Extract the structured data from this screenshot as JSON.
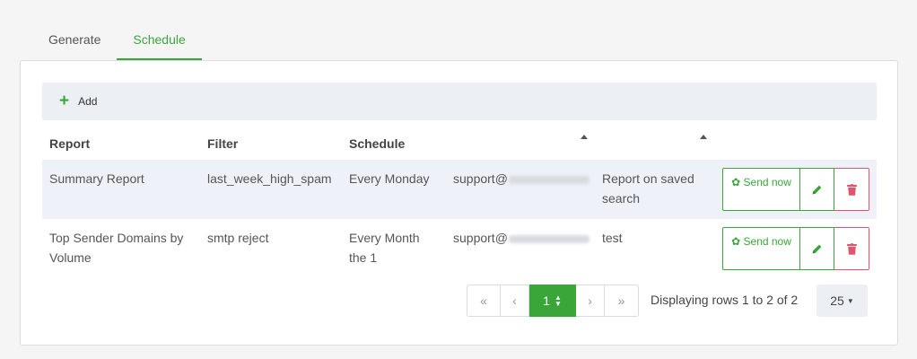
{
  "tabs": [
    {
      "label": "Generate",
      "active": false
    },
    {
      "label": "Schedule",
      "active": true
    }
  ],
  "toolbar": {
    "add_label": "Add"
  },
  "table": {
    "headers": {
      "report": "Report",
      "filter": "Filter",
      "schedule": "Schedule",
      "recipient": "",
      "description": ""
    },
    "rows": [
      {
        "report": "Summary Report",
        "filter": "last_week_high_spam",
        "schedule": "Every Monday",
        "email_prefix": "support@",
        "description": "Report on saved search",
        "send_label": "Send now"
      },
      {
        "report": "Top Sender Domains by Volume",
        "filter": "smtp reject",
        "schedule": "Every Month the 1",
        "email_prefix": "support@",
        "description": "test",
        "send_label": "Send now"
      }
    ]
  },
  "pagination": {
    "first": "«",
    "prev": "‹",
    "current": "1",
    "next": "›",
    "last": "»",
    "info": "Displaying rows 1 to 2 of 2",
    "page_size": "25"
  },
  "colors": {
    "accent": "#3aa63a",
    "danger": "#e0556e",
    "row_highlight": "#eef1f8"
  }
}
